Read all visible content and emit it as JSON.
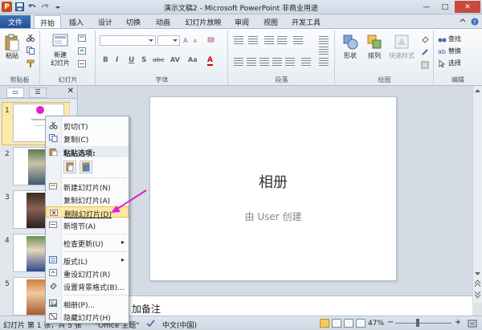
{
  "title_bar": {
    "title": "演示文稿2 - Microsoft PowerPoint 非商业用途",
    "min": "—",
    "max": "□",
    "close": "✕"
  },
  "tabs": [
    {
      "label": "文件"
    },
    {
      "label": "开始"
    },
    {
      "label": "插入"
    },
    {
      "label": "设计"
    },
    {
      "label": "切换"
    },
    {
      "label": "动画"
    },
    {
      "label": "幻灯片放映"
    },
    {
      "label": "审阅"
    },
    {
      "label": "视图"
    },
    {
      "label": "开发工具"
    }
  ],
  "ribbon": {
    "clipboard": {
      "paste": "粘贴",
      "label": "剪贴板"
    },
    "slides": {
      "new_slide": "新建\n幻灯片",
      "label": "幻灯片"
    },
    "font": {
      "bold": "B",
      "italic": "I",
      "underline": "U",
      "strike": "S",
      "shadow": "abc",
      "spacing": "AV",
      "case": "Aa",
      "color": "A",
      "label": "字体"
    },
    "paragraph": {
      "label": "段落"
    },
    "drawing": {
      "shapes": "形状",
      "arrange": "排列",
      "quick_styles": "快速样式",
      "label": "绘图"
    },
    "editing": {
      "find": "查找",
      "replace": "替换",
      "select": "选择",
      "label": "编辑"
    }
  },
  "panel": {
    "tab1": "▭",
    "tab2": "☰",
    "close": "✕",
    "slide_numbers": [
      "1",
      "2",
      "3",
      "4",
      "5"
    ]
  },
  "slide": {
    "title": "相册",
    "subtitle": "由 User 创建"
  },
  "notes": {
    "text": "加备注"
  },
  "context_menu": {
    "cut": "剪切(T)",
    "copy": "复制(C)",
    "paste_options": "粘贴选项:",
    "new_slide": "新建幻灯片(N)",
    "duplicate": "复制幻灯片(A)",
    "delete": "删除幻灯片(D)",
    "new_section": "新增节(A)",
    "check_updates": "检查更新(U)",
    "layout": "版式(L)",
    "reset": "重设幻灯片(R)",
    "format_bg": "设置背景格式(B)...",
    "album": "相册(P)...",
    "hide": "隐藏幻灯片(H)"
  },
  "status": {
    "slide_info": "幻灯片 第 1 张，共 5 张",
    "theme": "\"Office 主题\"",
    "language": "中文(中国)",
    "zoom": "47%",
    "minus": "−",
    "plus": "+"
  },
  "colors": {
    "file_tab": "#2b5797",
    "highlight": "#fde9a8",
    "arrow": "#e020d0"
  }
}
